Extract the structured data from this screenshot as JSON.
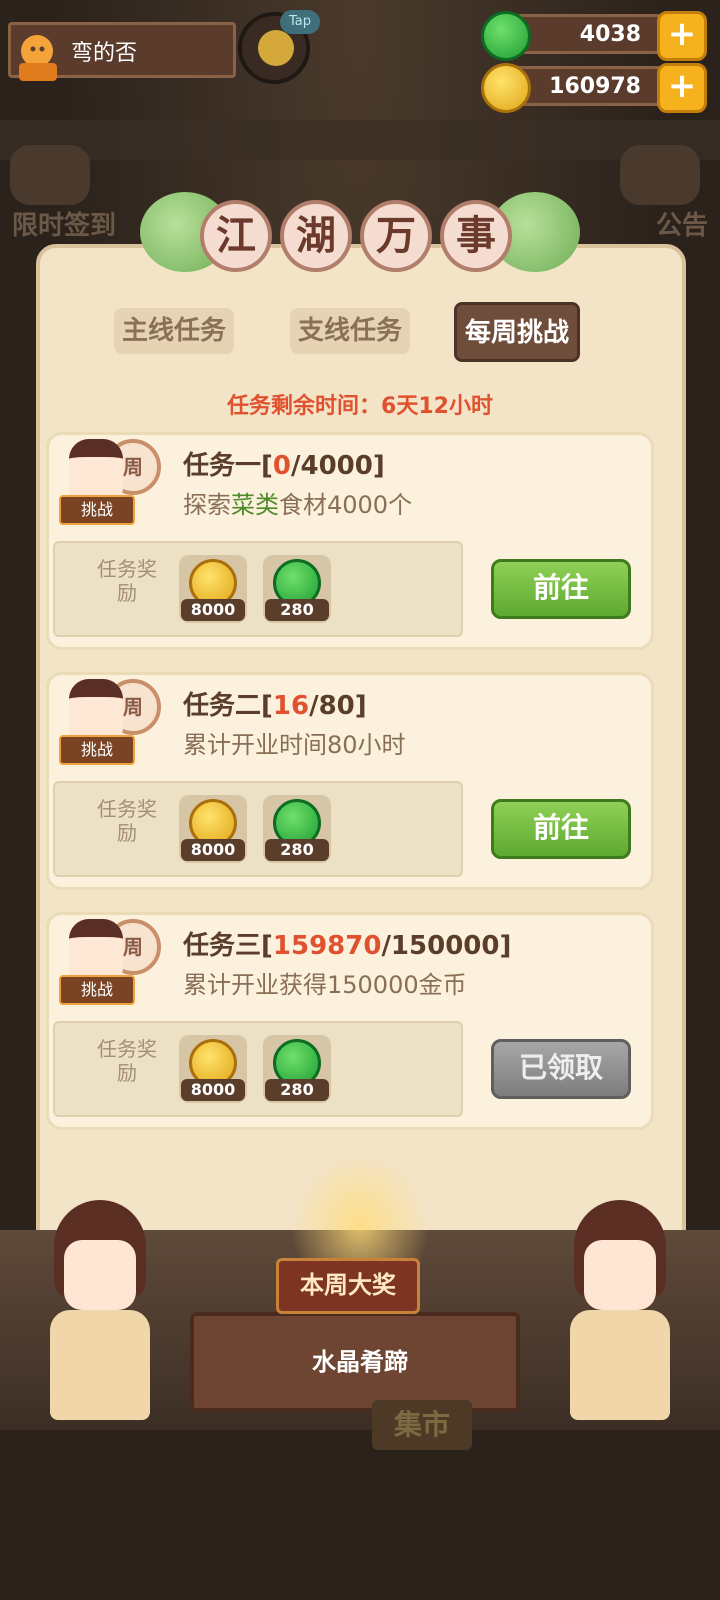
{
  "hud": {
    "player_name": "弯的否",
    "tap_label": "Tap",
    "jade_amount": "4038",
    "gold_amount": "160978",
    "plus": "+"
  },
  "background": {
    "left_label": "限时签到",
    "right_label": "公告",
    "market_label": "集市"
  },
  "panel": {
    "title_chars": [
      "江",
      "湖",
      "万",
      "事"
    ],
    "tabs": [
      {
        "label": "主线任务",
        "active": false
      },
      {
        "label": "支线任务",
        "active": false
      },
      {
        "label": "每周挑战",
        "active": true
      }
    ],
    "timer_text": "任务剩余时间：6天12小时"
  },
  "tasks": [
    {
      "title_prefix": "任务一[",
      "current": "0",
      "title_suffix": "/4000]",
      "desc_pre": "探索",
      "desc_hl": "菜类",
      "desc_post": "食材4000个",
      "reward_label": "任务奖励",
      "rewards": [
        {
          "amount": "8000",
          "type": "gold-coin"
        },
        {
          "amount": "280",
          "type": "jade-coin"
        }
      ],
      "button": "前往",
      "state": "go"
    },
    {
      "title_prefix": "任务二[",
      "current": "16",
      "title_suffix": "/80]",
      "desc_pre": "累计开业时间80小时",
      "desc_hl": "",
      "desc_post": "",
      "reward_label": "任务奖励",
      "rewards": [
        {
          "amount": "8000",
          "type": "gold-coin"
        },
        {
          "amount": "280",
          "type": "jade-coin"
        }
      ],
      "button": "前往",
      "state": "go"
    },
    {
      "title_prefix": "任务三[",
      "current": "159870",
      "title_suffix": "/150000]",
      "desc_pre": "累计开业获得150000金币",
      "desc_hl": "",
      "desc_post": "",
      "reward_label": "任务奖励",
      "rewards": [
        {
          "amount": "8000",
          "type": "gold-coin"
        },
        {
          "amount": "280",
          "type": "jade-coin"
        }
      ],
      "button": "已领取",
      "state": "claimed"
    }
  ],
  "badge": {
    "drum_char": "周",
    "label": "挑战"
  },
  "prize": {
    "title": "本周大奖",
    "name": "水晶肴蹄"
  },
  "colors": {
    "accent_red": "#e0522f",
    "go_green": "#5ea932",
    "claimed_gray": "#7d7d7d",
    "panel_bg": "#f3e4c8"
  }
}
